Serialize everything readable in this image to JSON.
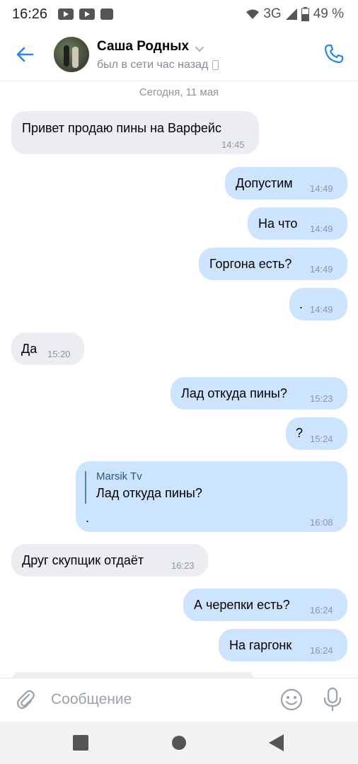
{
  "status_bar": {
    "time": "16:26",
    "network": "3G",
    "battery": "49 %",
    "icons": [
      "youtube-icon",
      "youtube-icon",
      "gmail-icon",
      "wifi-icon",
      "signal-icon",
      "battery-icon"
    ]
  },
  "header": {
    "contact_name": "Саша Родных",
    "last_seen": "был в сети час назад",
    "icons": [
      "back-arrow-icon",
      "chevron-down-icon",
      "mobile-device-icon",
      "phone-call-icon"
    ]
  },
  "chat": {
    "date_separator": "Сегодня, 11 мая",
    "messages": [
      {
        "dir": "in",
        "text": "Привет продаю пины на Варфейс",
        "time": "14:45"
      },
      {
        "dir": "out",
        "text": "Допустим",
        "time": "14:49"
      },
      {
        "dir": "out",
        "text": "На что",
        "time": "14:49"
      },
      {
        "dir": "out",
        "text": "Горгона есть?",
        "time": "14:49"
      },
      {
        "dir": "out",
        "text": ".",
        "time": "14:49"
      },
      {
        "dir": "in",
        "text": "Да",
        "time": "15:20"
      },
      {
        "dir": "out",
        "text": "Лад откуда пины?",
        "time": "15:23"
      },
      {
        "dir": "out",
        "text": "?",
        "time": "15:24"
      },
      {
        "dir": "out",
        "reply_author": "Marsik Tv",
        "reply_text": "Лад откуда пины?",
        "text": ".",
        "time": "16:08"
      },
      {
        "dir": "in",
        "text": "Друг скупщик отдаёт",
        "time": "16:23"
      },
      {
        "dir": "out",
        "text": "А черепки есть?",
        "time": "16:24"
      },
      {
        "dir": "out",
        "text": "На гаргонк",
        "time": "16:24"
      }
    ]
  },
  "composer": {
    "placeholder": "Сообщение",
    "icons": [
      "attach-icon",
      "emoji-icon",
      "microphone-icon"
    ]
  },
  "nav_bar": {
    "icons": [
      "recent-apps-icon",
      "home-icon",
      "back-icon"
    ]
  },
  "colors": {
    "accent": "#2688eb",
    "incoming_bubble": "#ebedf0",
    "outgoing_bubble": "#cce4ff"
  }
}
